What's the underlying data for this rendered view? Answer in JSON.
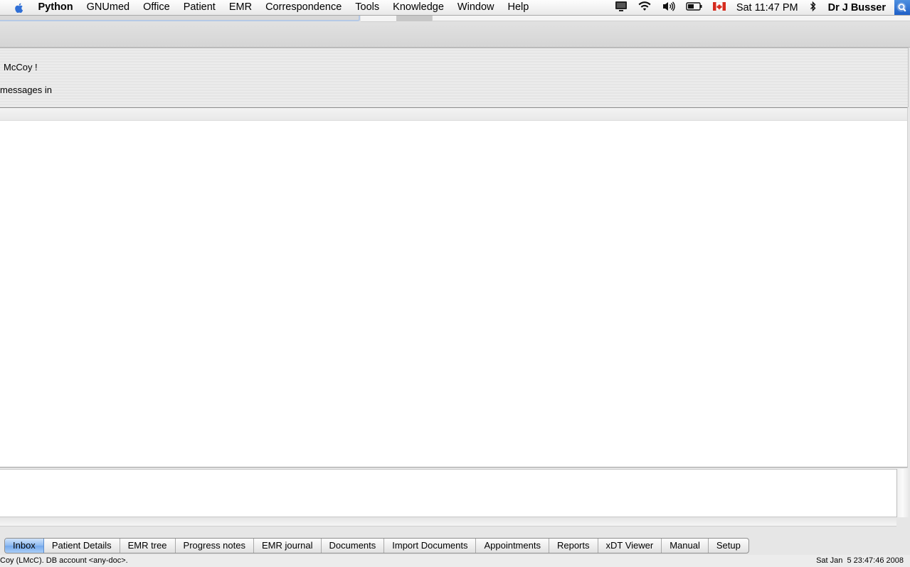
{
  "menubar": {
    "app_name": "Python",
    "items": [
      "GNUmed",
      "Office",
      "Patient",
      "EMR",
      "Correspondence",
      "Tools",
      "Knowledge",
      "Window",
      "Help"
    ],
    "clock": "Sat 11:47 PM",
    "user": "Dr J Busser",
    "status_icons": [
      "display-icon",
      "wifi-icon",
      "volume-icon",
      "battery-icon",
      "canada-flag-icon",
      "bluetooth-icon",
      "spotlight-icon"
    ]
  },
  "inbox": {
    "greeting": "McCoy !",
    "message_count_text": "messages in"
  },
  "tabs": [
    {
      "label": "Inbox",
      "active": true
    },
    {
      "label": "Patient Details"
    },
    {
      "label": "EMR tree"
    },
    {
      "label": "Progress notes"
    },
    {
      "label": "EMR journal"
    },
    {
      "label": "Documents"
    },
    {
      "label": "Import Documents"
    },
    {
      "label": "Appointments"
    },
    {
      "label": "Reports"
    },
    {
      "label": "xDT Viewer"
    },
    {
      "label": "Manual"
    },
    {
      "label": "Setup"
    }
  ],
  "statusbar": {
    "left": "Coy (LMcC). DB account <any-doc>.",
    "right": "Sat Jan  5 23:47:46 2008"
  },
  "colors": {
    "active_tab": "#8dbaf0",
    "spotlight": "#1e5fc7"
  }
}
